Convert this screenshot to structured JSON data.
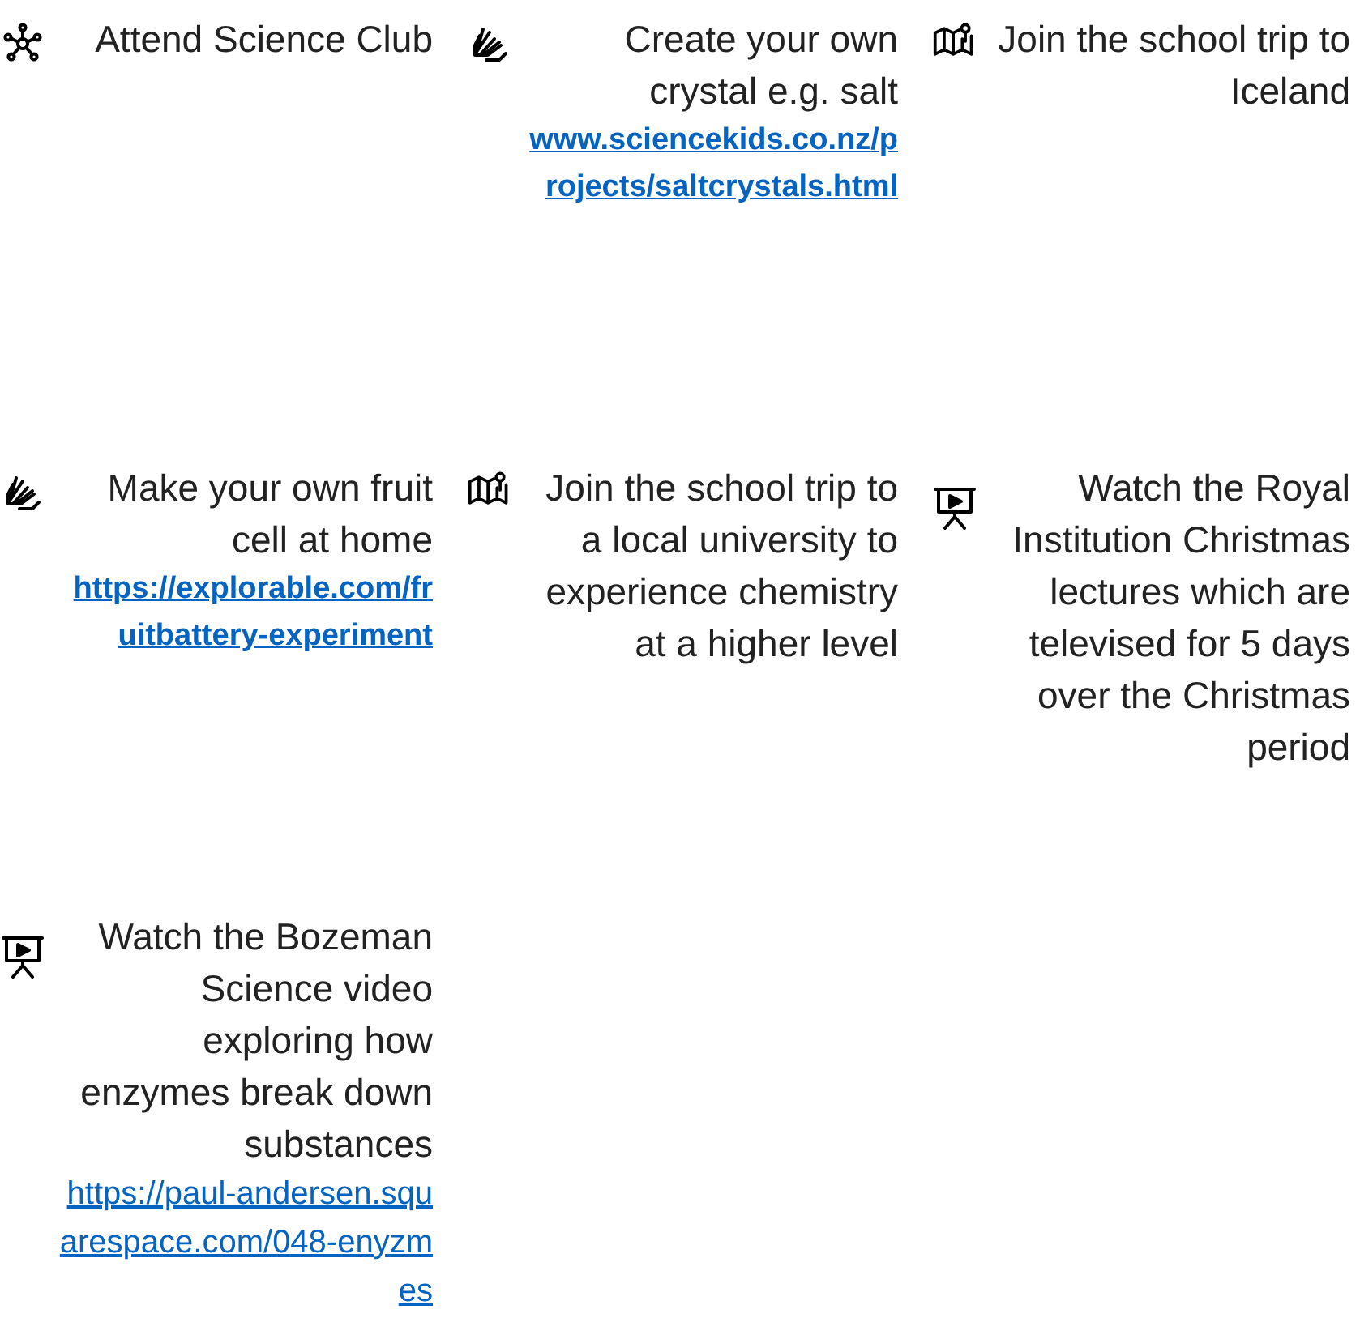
{
  "cards": [
    {
      "kind": "network",
      "text": "Attend Science Club"
    },
    {
      "kind": "hands",
      "text": "Create your own crystal e.g. salt",
      "link": {
        "text": "www.sciencekids.co.nz/projects/saltcrystals.html",
        "bold": true
      }
    },
    {
      "kind": "map",
      "text": "Join the school trip to Iceland"
    },
    {
      "kind": "hands",
      "text": "Make your own fruit cell at home",
      "link": {
        "text": "https://explorable.com/fruitbattery-experiment",
        "bold": true
      }
    },
    {
      "kind": "map",
      "text": "Join the school trip to a local university to experience chemistry at a higher level"
    },
    {
      "kind": "presentation",
      "text": "Watch the Royal Institution Christmas lectures which are televised for 5 days over the Christmas period"
    },
    {
      "kind": "presentation",
      "text": "Watch the Bozeman Science video exploring how enzymes break down substances",
      "link": {
        "text": "https://paul-andersen.squarespace.com/048-enyzmes",
        "bold": false
      }
    }
  ]
}
